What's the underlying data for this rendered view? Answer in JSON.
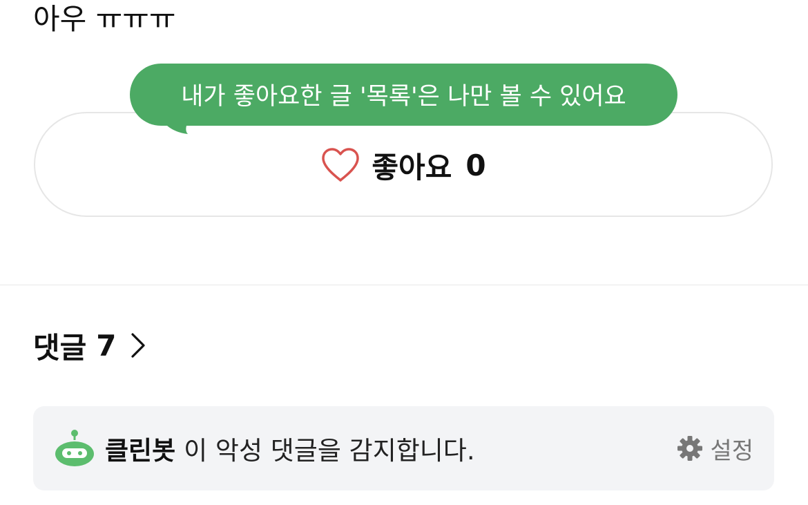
{
  "post": {
    "text": "아우 ㅠㅠㅠ"
  },
  "tooltip": {
    "text": "내가 좋아요한 글 '목록'은 나만 볼 수 있어요",
    "color": "#4caa64"
  },
  "like": {
    "icon": "heart-outline-icon",
    "label": "좋아요",
    "count": "0",
    "heart_color": "#d9534f"
  },
  "comments": {
    "title": "댓글",
    "count": "7",
    "icon": "chevron-right-icon"
  },
  "cleanbot": {
    "icon": "robot-icon",
    "name": "클린봇",
    "message": "이 악성 댓글을 감지합니다.",
    "settings_icon": "gear-icon",
    "settings_label": "설정",
    "robot_color": "#5cbd6e"
  }
}
